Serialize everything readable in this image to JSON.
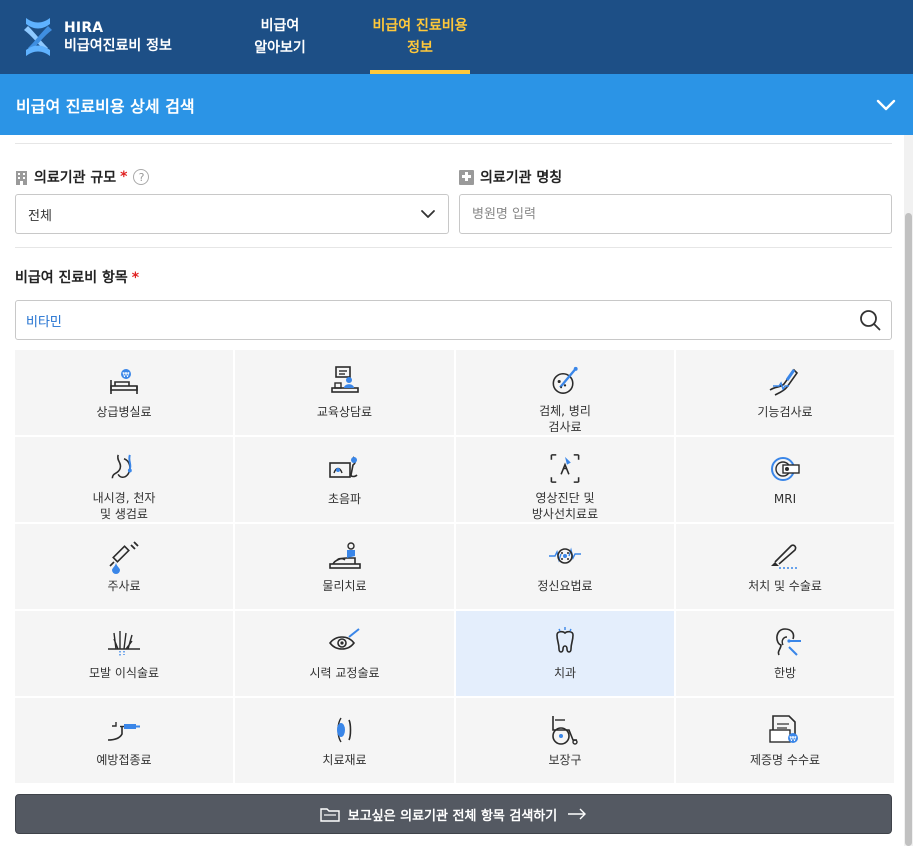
{
  "header": {
    "logo_line1": "HIRA",
    "logo_line2": "비급여진료비 정보",
    "nav": [
      {
        "label": "비급여\n알아보기",
        "active": false
      },
      {
        "label": "비급여 진료비용\n정보",
        "active": true
      }
    ]
  },
  "section": {
    "title": "비급여 진료비용 상세 검색"
  },
  "filters": {
    "scale_label": "의료기관 규모",
    "required_mark": "*",
    "help_mark": "?",
    "scale_value": "전체",
    "name_label": "의료기관 명칭",
    "name_placeholder": "병원명 입력"
  },
  "items": {
    "label": "비급여 진료비 항목",
    "required_mark": "*",
    "search_value": "비타민",
    "categories": [
      {
        "label": "상급병실료",
        "icon": "hospital-bed-icon"
      },
      {
        "label": "교육상담료",
        "icon": "counseling-icon"
      },
      {
        "label": "검체, 병리\n검사료",
        "icon": "specimen-icon"
      },
      {
        "label": "기능검사료",
        "icon": "function-test-icon"
      },
      {
        "label": "내시경, 천자\n및 생검료",
        "icon": "endoscope-icon"
      },
      {
        "label": "초음파",
        "icon": "ultrasound-icon"
      },
      {
        "label": "영상진단 및\n방사선치료료",
        "icon": "imaging-icon"
      },
      {
        "label": "MRI",
        "icon": "mri-icon"
      },
      {
        "label": "주사료",
        "icon": "syringe-icon"
      },
      {
        "label": "물리치료",
        "icon": "physical-therapy-icon"
      },
      {
        "label": "정신요법료",
        "icon": "brain-icon"
      },
      {
        "label": "처치 및 수술료",
        "icon": "scalpel-icon"
      },
      {
        "label": "모발 이식술료",
        "icon": "hair-icon"
      },
      {
        "label": "시력 교정술료",
        "icon": "eye-icon"
      },
      {
        "label": "치과",
        "icon": "tooth-icon"
      },
      {
        "label": "한방",
        "icon": "ear-acupuncture-icon"
      },
      {
        "label": "예방접종료",
        "icon": "vaccination-icon"
      },
      {
        "label": "치료재료",
        "icon": "lens-icon"
      },
      {
        "label": "보장구",
        "icon": "wheelchair-icon"
      },
      {
        "label": "제증명 수수료",
        "icon": "certificate-icon"
      }
    ],
    "selected_index": 14
  },
  "bottom_button": {
    "label": "보고싶은 의료기관 전체 항목 검색하기"
  },
  "colors": {
    "header_bg": "#1d4f86",
    "section_bg": "#2b94e6",
    "active_nav": "#ffc83a",
    "accent_blue": "#3a86e8",
    "button_bg": "#545962"
  }
}
